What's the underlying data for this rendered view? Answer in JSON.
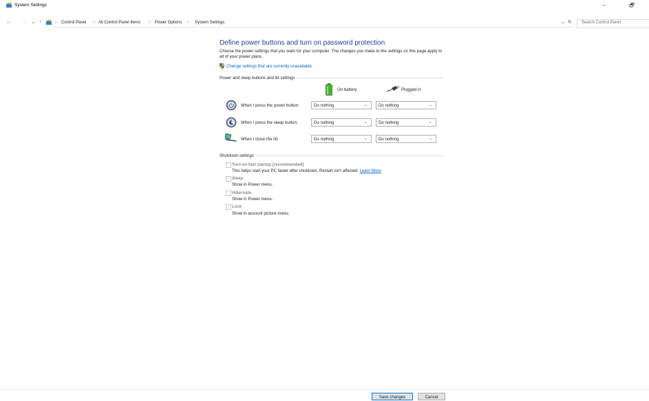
{
  "window": {
    "title": "System Settings",
    "minimize": "–",
    "restore": "🗗"
  },
  "nav": {
    "back": "←",
    "forward": "→",
    "recent": "⌄",
    "up": "↑",
    "breadcrumb": [
      "Control Panel",
      "All Control Panel Items",
      "Power Options",
      "System Settings"
    ],
    "separator": "›",
    "dropdown": "⌄",
    "refresh": "↻",
    "search_placeholder": "Search Control Panel"
  },
  "main": {
    "heading": "Define power buttons and turn on password protection",
    "description": "Choose the power settings that you want for your computer. The changes you make to the settings on this page apply to all of your power plans.",
    "change_link": "Change settings that are currently unavailable"
  },
  "power": {
    "group_label": "Power and sleep buttons and lid settings",
    "col_battery": "On battery",
    "col_plugged": "Plugged in",
    "chevron": "⌄",
    "rows": [
      {
        "label": "When I press the power button:",
        "battery": "Do nothing",
        "plugged": "Do nothing",
        "icon": "power-button-icon"
      },
      {
        "label": "When I press the sleep button:",
        "battery": "Do nothing",
        "plugged": "Do nothing",
        "icon": "sleep-button-icon"
      },
      {
        "label": "When I close the lid:",
        "battery": "Do nothing",
        "plugged": "Do nothing",
        "icon": "laptop-lid-icon"
      }
    ]
  },
  "shutdown": {
    "group_label": "Shutdown settings",
    "check_mark": "✓",
    "items": [
      {
        "label": "Turn on fast startup (recommended)",
        "sub": "This helps start your PC faster after shutdown. Restart isn't affected.",
        "link": "Learn More",
        "checked": false
      },
      {
        "label": "Sleep",
        "sub": "Show in Power menu.",
        "checked": true
      },
      {
        "label": "Hibernate",
        "sub": "Show in Power menu.",
        "checked": false
      },
      {
        "label": "Lock",
        "sub": "Show in account picture menu.",
        "checked": true
      }
    ]
  },
  "footer": {
    "save": "Save changes",
    "cancel": "Cancel"
  },
  "colors": {
    "heading": "#1e3f99",
    "link": "#0066cc",
    "accent": "#0078d7"
  }
}
